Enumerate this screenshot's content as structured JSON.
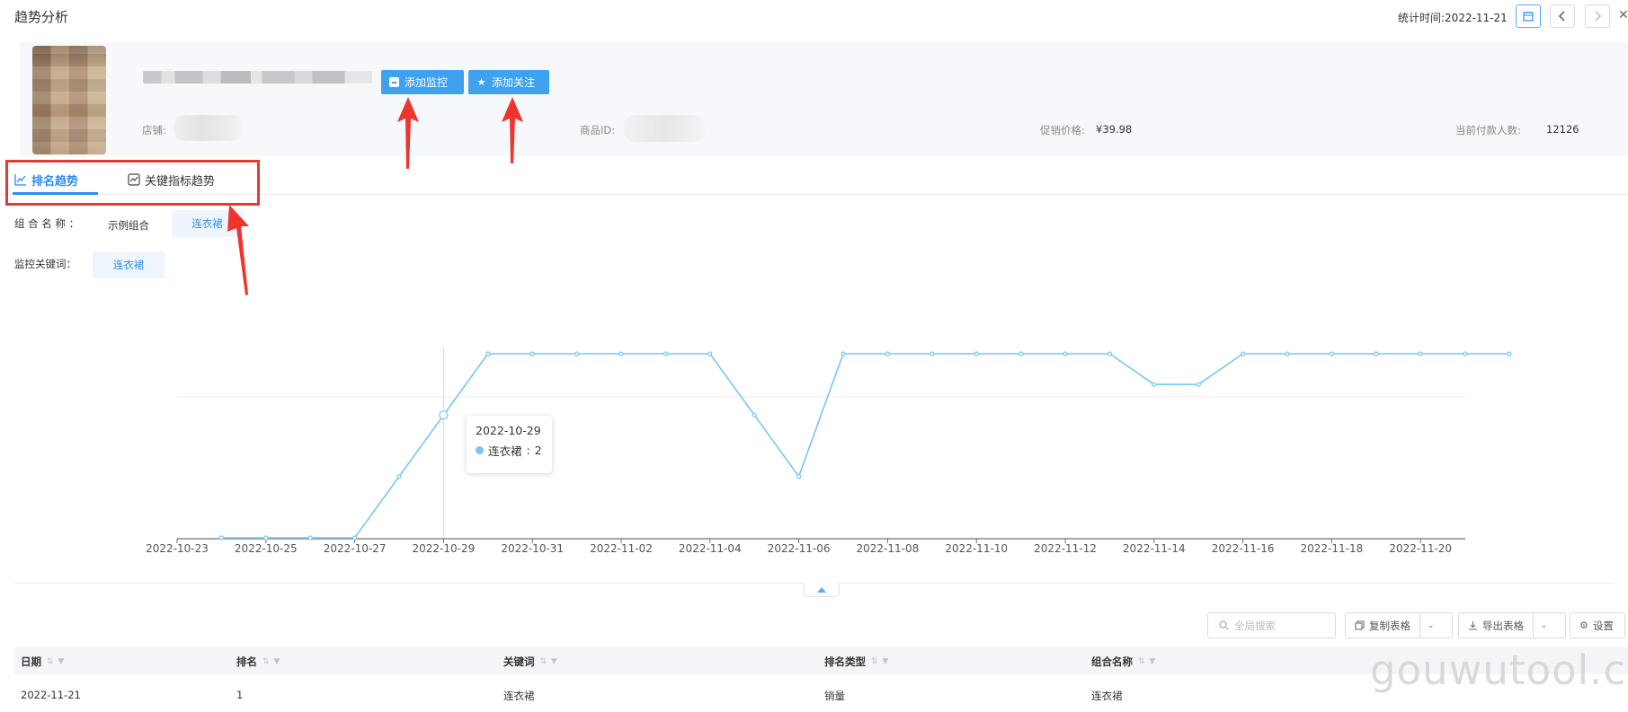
{
  "header": {
    "title": "趋势分析",
    "stat_time": "统计时间:2022-11-21"
  },
  "product": {
    "monitor_button": "添加监控",
    "follow_button": "添加关注",
    "shop_label": "店铺:",
    "item_id_label": "商品ID:",
    "promo_price_label": "促销价格:",
    "promo_price_value": "¥39.98",
    "buyers_label": "当前付款人数:",
    "buyers_value": "12126"
  },
  "tabs": [
    {
      "label": "排名趋势",
      "active": true
    },
    {
      "label": "关键指标趋势",
      "active": false
    }
  ],
  "filters": {
    "group_label": "组 合 名 称 ：",
    "group_options": [
      "示例组合",
      "连衣裙"
    ],
    "keyword_label": "监控关键词：",
    "keyword_value": "连衣裙"
  },
  "chart_data": {
    "type": "line",
    "series": [
      {
        "name": "连衣裙",
        "color": "#79c4f5",
        "values": [
          null,
          4,
          4,
          4,
          4,
          3,
          2,
          1,
          1,
          1,
          1,
          1,
          1,
          2,
          3,
          1,
          1,
          1,
          1,
          1,
          1,
          1,
          1.5,
          1.5,
          1,
          1,
          1,
          1,
          1,
          1,
          1
        ]
      }
    ],
    "x": [
      "2022-10-23",
      "2022-10-24",
      "2022-10-25",
      "2022-10-26",
      "2022-10-27",
      "2022-10-28",
      "2022-10-29",
      "2022-10-30",
      "2022-10-31",
      "2022-11-01",
      "2022-11-02",
      "2022-11-03",
      "2022-11-04",
      "2022-11-05",
      "2022-11-06",
      "2022-11-07",
      "2022-11-08",
      "2022-11-09",
      "2022-11-10",
      "2022-11-11",
      "2022-11-12",
      "2022-11-13",
      "2022-11-14",
      "2022-11-15",
      "2022-11-16",
      "2022-11-17",
      "2022-11-18",
      "2022-11-19",
      "2022-11-20",
      "2022-11-21"
    ],
    "tick_labels": [
      "2022-10-23",
      "2022-10-25",
      "2022-10-27",
      "2022-10-29",
      "2022-10-31",
      "2022-11-02",
      "2022-11-04",
      "2022-11-06",
      "2022-11-08",
      "2022-11-10",
      "2022-11-12",
      "2022-11-14",
      "2022-11-16",
      "2022-11-18",
      "2022-11-20"
    ],
    "y_inverted": true,
    "ylim": [
      1,
      4
    ],
    "grid": true,
    "tooltip": {
      "date": "2022-10-29",
      "series": "连衣裙",
      "value": "2"
    }
  },
  "table": {
    "search_placeholder": "全局搜索",
    "copy_button": "复制表格",
    "export_button": "导出表格",
    "settings_button": "设置",
    "columns": [
      "日期",
      "排名",
      "关键词",
      "排名类型",
      "组合名称"
    ],
    "rows": [
      [
        "2022-11-21",
        "1",
        "连衣裙",
        "销量",
        "连衣裙"
      ]
    ]
  },
  "watermark": "gouwutool.cn",
  "colors": {
    "accent": "#2f8cf0",
    "button": "#3ea2f0",
    "line": "#79c4f5",
    "annotation": "#e53935"
  }
}
